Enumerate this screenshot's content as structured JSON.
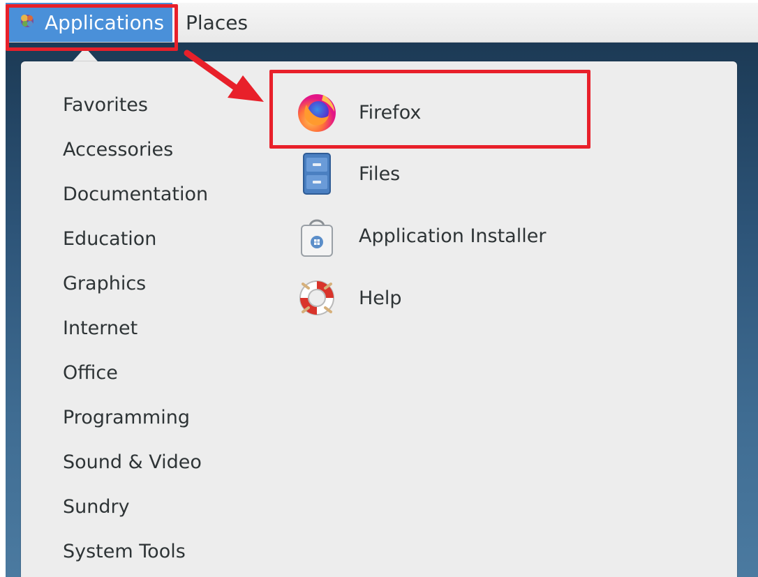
{
  "topbar": {
    "applications_label": "Applications",
    "places_label": "Places"
  },
  "menu": {
    "categories": [
      "Favorites",
      "Accessories",
      "Documentation",
      "Education",
      "Graphics",
      "Internet",
      "Office",
      "Programming",
      "Sound & Video",
      "Sundry",
      "System Tools"
    ],
    "apps": [
      {
        "name": "Firefox",
        "icon": "firefox-icon"
      },
      {
        "name": "Files",
        "icon": "file-cabinet-icon"
      },
      {
        "name": "Application Installer",
        "icon": "shopping-bag-icon"
      },
      {
        "name": "Help",
        "icon": "lifebuoy-icon"
      }
    ]
  },
  "annotations": {
    "highlight_color": "#e8202a",
    "arrow": "from-applications-to-firefox"
  },
  "colors": {
    "accent": "#4a90d9",
    "menu_bg": "#ededed",
    "text": "#2e3436"
  }
}
